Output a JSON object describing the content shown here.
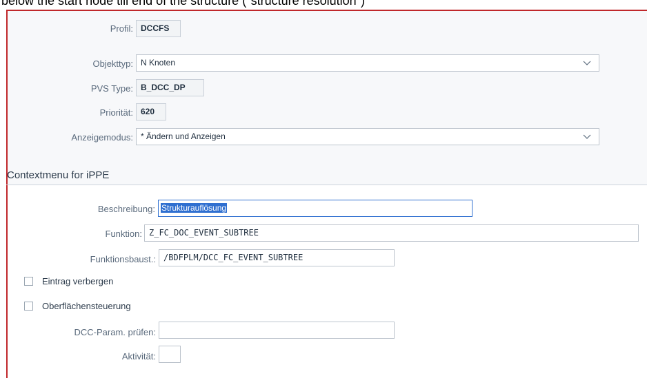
{
  "caption": "below the start node till end of the structure (\"structure resolution\")",
  "header": {
    "profil": {
      "label": "Profil:",
      "value": "DCCFS"
    },
    "objekttyp": {
      "label": "Objekttyp:",
      "value": "N Knoten"
    },
    "pvs_type": {
      "label": "PVS Type:",
      "value": "B_DCC_DP"
    },
    "prioritaet": {
      "label": "Priorität:",
      "value": "620"
    },
    "anzeigemodus": {
      "label": "Anzeigemodus:",
      "value": "* Ändern und Anzeigen"
    }
  },
  "section": {
    "title": "Contextmenu for iPPE",
    "beschreibung": {
      "label": "Beschreibung:",
      "value": "Strukturauflösung"
    },
    "funktion": {
      "label": "Funktion:",
      "value": "Z_FC_DOC_EVENT_SUBTREE"
    },
    "funktionsbaust": {
      "label": "Funktionsbaust.:",
      "value": "/BDFPLM/DCC_FC_EVENT_SUBTREE"
    },
    "eintrag_verbergen": {
      "label": "Eintrag verbergen",
      "checked": false
    },
    "oberflaechensteuerung": {
      "label": "Oberflächensteuerung",
      "checked": false
    },
    "dcc_param": {
      "label": "DCC-Param. prüfen:",
      "value": ""
    },
    "aktivitaet": {
      "label": "Aktivität:",
      "value": ""
    }
  },
  "icons": {
    "dropdown": "chevron-down-icon",
    "checkbox": "checkbox-icon"
  },
  "colors": {
    "frame_border": "#c0282b",
    "selection": "#2f6fd0",
    "label": "#5a6a7c"
  }
}
